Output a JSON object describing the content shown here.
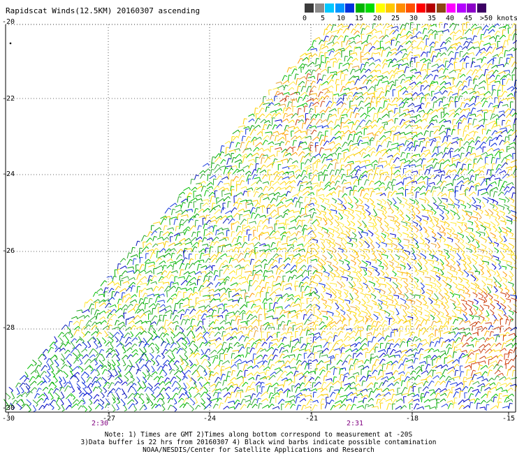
{
  "title": "Rapidscat Winds(12.5KM) 20160307 ascending",
  "legend": {
    "labels": [
      "0",
      "5",
      "10",
      "15",
      "20",
      "25",
      "30",
      "35",
      "40",
      "45",
      ">50 knots"
    ],
    "colors": [
      "#3c3c3c",
      "#8c8c8c",
      "#00c8ff",
      "#0096ff",
      "#0032dc",
      "#00b400",
      "#00dc00",
      "#ffff00",
      "#ffc800",
      "#ff8c00",
      "#ff5000",
      "#ff0000",
      "#b40000",
      "#8c4614",
      "#ff00ff",
      "#b400ff",
      "#8c00c8",
      "#3c0064"
    ]
  },
  "axes": {
    "lat_labels": [
      "-20",
      "-22",
      "-24",
      "-26",
      "-28",
      "-30"
    ],
    "lon_labels": [
      "-30",
      "-27",
      "-24",
      "-21",
      "-18",
      "-15"
    ]
  },
  "times": [
    "2:30",
    "2:31"
  ],
  "notes": [
    "Note: 1) Times are GMT 2)Times along bottom correspond to measurement at -20S",
    "3)Data buffer is 22 hrs from 20160307 4) Black wind barbs indicate possible contamination",
    "NOAA/NESDIS/Center for Satellite Applications and Research"
  ]
}
